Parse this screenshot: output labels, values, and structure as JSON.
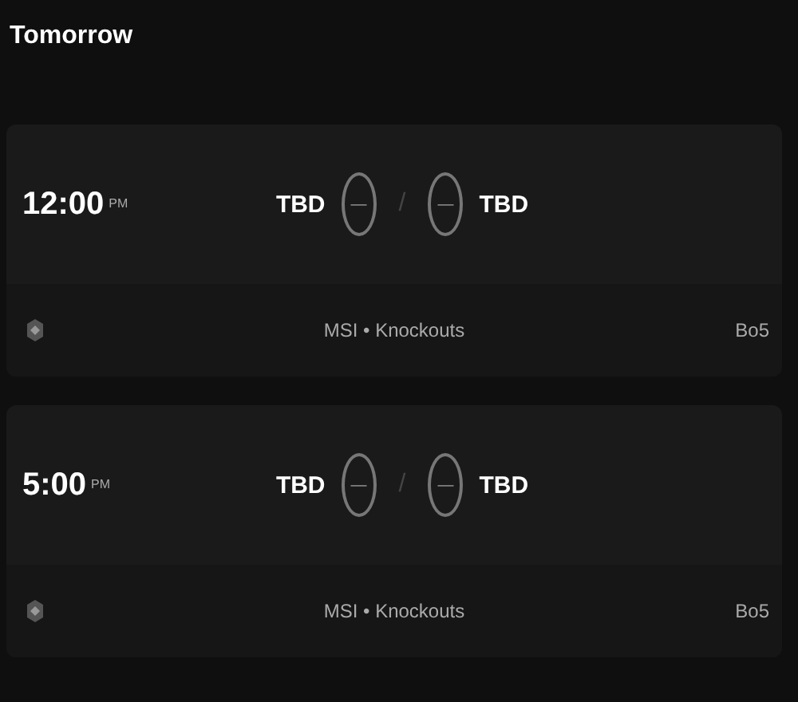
{
  "heading": "Tomorrow",
  "matches": [
    {
      "time": "12:00",
      "period": "PM",
      "team_1": "TBD",
      "score_1": "—",
      "separator": "/",
      "score_2": "—",
      "team_2": "TBD",
      "event": "MSI • Knockouts",
      "format": "Bo5"
    },
    {
      "time": "5:00",
      "period": "PM",
      "team_1": "TBD",
      "score_1": "—",
      "separator": "/",
      "score_2": "—",
      "team_2": "TBD",
      "event": "MSI • Knockouts",
      "format": "Bo5"
    }
  ]
}
